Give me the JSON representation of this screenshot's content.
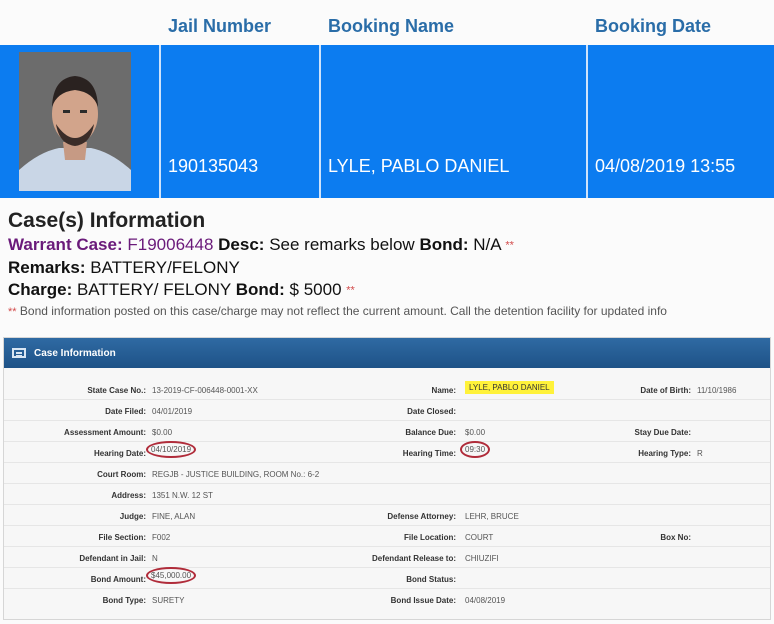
{
  "booking": {
    "headers": {
      "jail_number": "Jail Number",
      "booking_name": "Booking Name",
      "booking_date": "Booking Date"
    },
    "jail_number": "190135043",
    "booking_name": "LYLE, PABLO DANIEL",
    "booking_date": "04/08/2019 13:55",
    "row_color": "#0c7cf0"
  },
  "cases": {
    "title": "Case(s) Information",
    "warrant_label": "Warrant Case:",
    "warrant_number": "F19006448",
    "desc_label": "Desc:",
    "desc_value": "See remarks below",
    "bond_label": "Bond:",
    "bond_value": "N/A",
    "stars": "**",
    "remarks_label": "Remarks:",
    "remarks_value": "BATTERY/FELONY",
    "charge_label": "Charge:",
    "charge_value": "BATTERY/ FELONY",
    "charge_bond_label": "Bond:",
    "charge_bond_value": "$ 5000",
    "note_stars": "**",
    "note": "Bond information posted on this case/charge may not reflect the current amount. Call the detention facility for updated info"
  },
  "panel": {
    "title": "Case Information",
    "rows": [
      {
        "l1": "State Case No.:",
        "v1": "13-2019-CF-006448-0001-XX",
        "l2": "Name:",
        "v2": "LYLE, PABLO DANIEL",
        "l3": "Date of Birth:",
        "v3": "11/10/1986"
      },
      {
        "l1": "Date Filed:",
        "v1": "04/01/2019",
        "l2": "Date Closed:",
        "v2": "",
        "l3": "",
        "v3": ""
      },
      {
        "l1": "Assessment Amount:",
        "v1": "$0.00",
        "l2": "Balance Due:",
        "v2": "$0.00",
        "l3": "Stay Due Date:",
        "v3": ""
      },
      {
        "l1": "Hearing Date:",
        "v1": "04/10/2019",
        "l2": "Hearing Time:",
        "v2": "09:30",
        "l3": "Hearing Type:",
        "v3": "R"
      },
      {
        "l1": "Court Room:",
        "v1": "REGJB - JUSTICE BUILDING, ROOM No.: 6-2",
        "l2": "",
        "v2": "",
        "l3": "",
        "v3": ""
      },
      {
        "l1": "Address:",
        "v1": "1351 N.W. 12 ST",
        "l2": "",
        "v2": "",
        "l3": "",
        "v3": ""
      },
      {
        "l1": "Judge:",
        "v1": "FINE, ALAN",
        "l2": "Defense Attorney:",
        "v2": "LEHR, BRUCE",
        "l3": "",
        "v3": ""
      },
      {
        "l1": "File Section:",
        "v1": "F002",
        "l2": "File Location:",
        "v2": "COURT",
        "l3": "Box No:",
        "v3": ""
      },
      {
        "l1": "Defendant in Jail:",
        "v1": "N",
        "l2": "Defendant Release to:",
        "v2": "CHIUZIFI",
        "l3": "",
        "v3": ""
      },
      {
        "l1": "Bond Amount:",
        "v1": "$45,000.00",
        "l2": "Bond Status:",
        "v2": "",
        "l3": "",
        "v3": ""
      },
      {
        "l1": "Bond Type:",
        "v1": "SURETY",
        "l2": "Bond Issue Date:",
        "v2": "04/08/2019",
        "l3": "",
        "v3": ""
      }
    ]
  }
}
